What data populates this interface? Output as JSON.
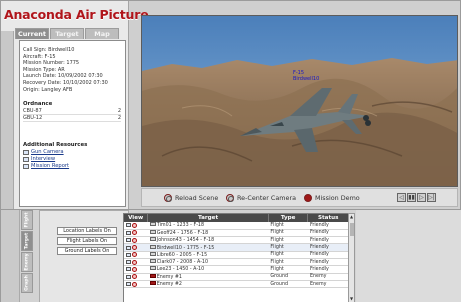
{
  "app": {
    "title": "Anaconda Air Picture"
  },
  "tabs": [
    {
      "label": "Current",
      "active": true
    },
    {
      "label": "Target",
      "active": false
    },
    {
      "label": "Map",
      "active": false
    }
  ],
  "mission": {
    "lines": [
      "Call Sign: Birdwell10",
      "Aircraft: F-15",
      "Mission Number: 1775",
      "Mission Type: AR",
      "Launch Date: 10/09/2002 07:30",
      "Recovery Date: 10/10/2002 07:30",
      "Origin: Langley AFB"
    ]
  },
  "ordnance": {
    "title": "Ordnance",
    "rows": [
      {
        "name": "CBU-87",
        "qty": "2"
      },
      {
        "name": "GBU-12",
        "qty": "2"
      }
    ]
  },
  "resources": {
    "title": "Additional Resources",
    "items": [
      {
        "label": "Gun Camera"
      },
      {
        "label": "Interview"
      },
      {
        "label": "Mission Report"
      }
    ]
  },
  "viewport": {
    "callout_line1": "F-15",
    "callout_line2": "Birdwell10"
  },
  "controls": {
    "reload": "Reload Scene",
    "recenter": "Re-Center Camera",
    "demo": "Mission Demo",
    "media": [
      "◁",
      "▮▮",
      "▷",
      "▷|"
    ]
  },
  "side_tabs": [
    "Flight",
    "Target",
    "Enemy",
    "Graph"
  ],
  "label_buttons": [
    {
      "label": "Location Labels On"
    },
    {
      "label": "Flight Labels On"
    },
    {
      "label": "Ground Labels On"
    }
  ],
  "grid": {
    "columns": [
      "View",
      "Target",
      "Type",
      "Status"
    ],
    "rows": [
      {
        "target": "Tim01 - 1233 - F-18",
        "type": "Flight",
        "status": "Friendly",
        "enemy": false,
        "selected": false
      },
      {
        "target": "Geoff24 - 1756 - F-18",
        "type": "Flight",
        "status": "Friendly",
        "enemy": false,
        "selected": false
      },
      {
        "target": "Johnson43 - 1454 - F-18",
        "type": "Flight",
        "status": "Friendly",
        "enemy": false,
        "selected": false
      },
      {
        "target": "Birdwell10 - 1775 - F-15",
        "type": "Flight",
        "status": "Friendly",
        "enemy": false,
        "selected": true
      },
      {
        "target": "Libre60 - 2005 - F-15",
        "type": "Flight",
        "status": "Friendly",
        "enemy": false,
        "selected": false
      },
      {
        "target": "Clark07 - 2008 - A-10",
        "type": "Flight",
        "status": "Friendly",
        "enemy": false,
        "selected": false
      },
      {
        "target": "Lee23 - 1450 - A-10",
        "type": "Flight",
        "status": "Friendly",
        "enemy": false,
        "selected": false
      },
      {
        "target": "Enemy #1",
        "type": "Ground",
        "status": "Enemy",
        "enemy": true,
        "selected": false
      },
      {
        "target": "Enemy #2",
        "type": "Ground",
        "status": "Enemy",
        "enemy": true,
        "selected": false
      }
    ]
  },
  "colors": {
    "brand": "#b0151b",
    "sky": "#5b8ec4",
    "terrain": "#9a7a58",
    "header": "#4a4a4a"
  }
}
